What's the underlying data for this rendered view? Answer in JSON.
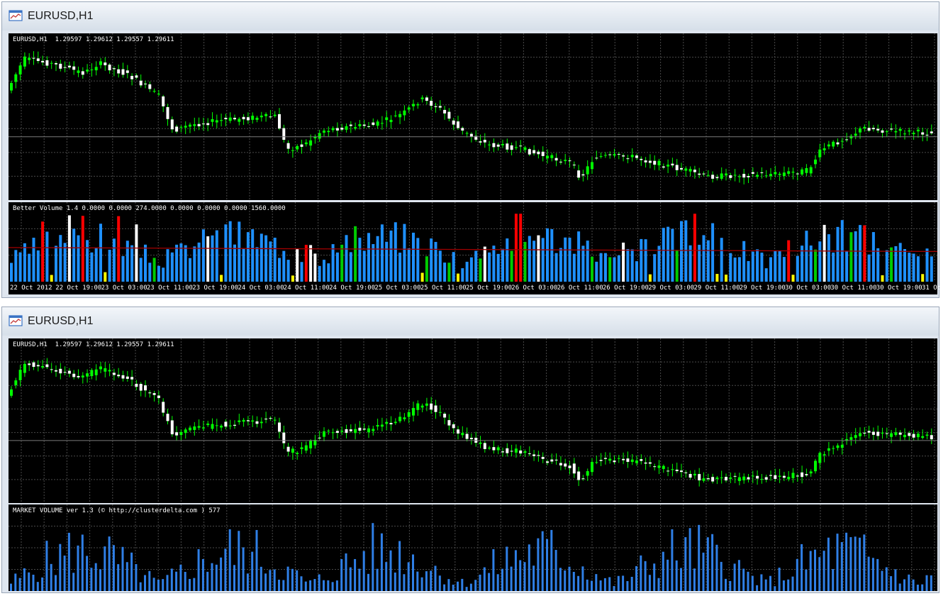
{
  "window1": {
    "title": "EURUSD,H1",
    "price_label": "EURUSD,H1  1.29597 1.29612 1.29557 1.29611",
    "indicator_label": "Better Volume 1.4 0.0000 0.0000 274.0000 0.0000 0.0000 0.0000 1560.0000",
    "time_labels": [
      "22 Oct 2012",
      "22 Oct 19:00",
      "23 Oct 03:00",
      "23 Oct 11:00",
      "23 Oct 19:00",
      "24 Oct 03:00",
      "24 Oct 11:00",
      "24 Oct 19:00",
      "25 Oct 03:00",
      "25 Oct 11:00",
      "25 Oct 19:00",
      "26 Oct 03:00",
      "26 Oct 11:00",
      "26 Oct 19:00",
      "29 Oct 03:00",
      "29 Oct 11:00",
      "29 Oct 19:00",
      "30 Oct 03:00",
      "30 Oct 11:00",
      "30 Oct 19:00",
      "31 Oct"
    ]
  },
  "window2": {
    "title": "EURUSD,H1",
    "price_label": "EURUSD,H1  1.29597 1.29612 1.29557 1.29611",
    "indicator_label": "MARKET VOLUME ver 1.3 (© http://clusterdelta.com ) 577"
  },
  "colors": {
    "candle_up": "#00ff00",
    "candle_down": "#ffffff",
    "volume_bar": "#1e90ff",
    "market_volume_bar": "#2f7fe6",
    "climax": "#ff0000",
    "churn": "#00cc00",
    "low_volume": "#ffff00",
    "high_volume_white": "#ffffff",
    "average_line": "#a00000",
    "grid": "#4a4a4a"
  }
}
